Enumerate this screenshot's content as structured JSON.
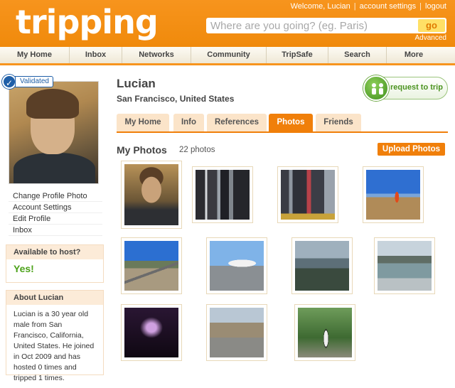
{
  "header": {
    "logo": "tripping",
    "welcome": "Welcome, Lucian",
    "account_settings": "account settings",
    "logout": "logout",
    "search_placeholder": "Where are you going? (eg. Paris)",
    "go_label": "go",
    "advanced": "Advanced",
    "brand_color": "#f7941d"
  },
  "nav": {
    "items": [
      {
        "label": "My Home"
      },
      {
        "label": "Inbox"
      },
      {
        "label": "Networks"
      },
      {
        "label": "Community"
      },
      {
        "label": "TripSafe"
      },
      {
        "label": "Search"
      },
      {
        "label": "More"
      }
    ]
  },
  "sidebar": {
    "validated": "Validated",
    "links": [
      "Change Profile Photo",
      "Account Settings",
      "Edit Profile",
      "Inbox"
    ],
    "host_title": "Available to host?",
    "host_value": "Yes!",
    "about_title": "About Lucian",
    "about_text": "Lucian is a 30 year old male from San Francisco, California, United States. He joined in Oct 2009 and has hosted 0 times and tripped 1 times."
  },
  "profile": {
    "name": "Lucian",
    "location": "San Francisco, United States",
    "request_button": "request to trip"
  },
  "tabs": [
    {
      "label": "My Home",
      "active": false
    },
    {
      "label": "Info",
      "active": false
    },
    {
      "label": "References",
      "active": false
    },
    {
      "label": "Photos",
      "active": true
    },
    {
      "label": "Friends",
      "active": false
    }
  ],
  "photos": {
    "title": "My Photos",
    "count": "22 photos",
    "upload": "Upload Photos",
    "items": [
      {
        "name": "photo-portrait"
      },
      {
        "name": "photo-times-square-1"
      },
      {
        "name": "photo-times-square-2"
      },
      {
        "name": "photo-desert-person"
      },
      {
        "name": "photo-road-hills"
      },
      {
        "name": "photo-airplane"
      },
      {
        "name": "photo-misty-hills"
      },
      {
        "name": "photo-lake-view"
      },
      {
        "name": "photo-concert-stage"
      },
      {
        "name": "photo-museum-steps"
      },
      {
        "name": "photo-person-trees"
      }
    ]
  }
}
